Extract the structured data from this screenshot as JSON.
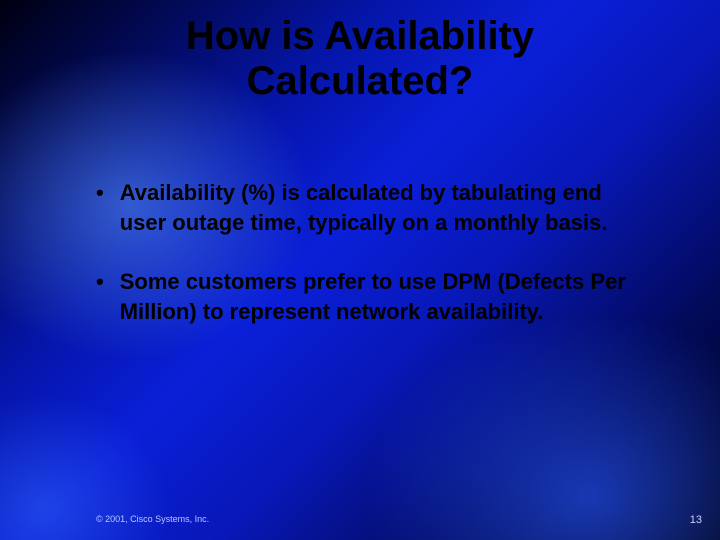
{
  "title_line1": "How is Availability",
  "title_line2": "Calculated?",
  "bullets": [
    "Availability (%) is calculated by tabulating end user outage time,  typically on a monthly basis.",
    "Some customers prefer to use DPM (Defects Per Million) to represent network availability."
  ],
  "footer": {
    "copyright": "© 2001, Cisco Systems, Inc.",
    "page_number": "13"
  }
}
